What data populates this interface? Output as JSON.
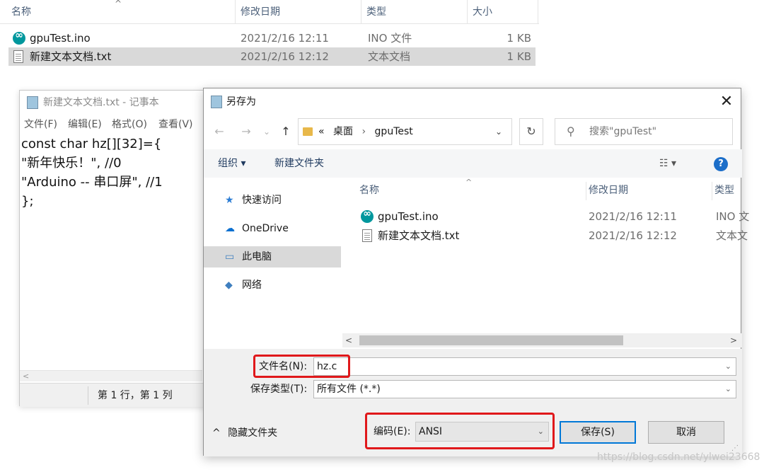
{
  "explorer": {
    "columns": [
      "名称",
      "修改日期",
      "类型",
      "大小"
    ],
    "files": [
      {
        "name": "gpuTest.ino",
        "date": "2021/2/16 12:11",
        "type": "INO 文件",
        "size": "1 KB"
      },
      {
        "name": "新建文本文档.txt",
        "date": "2021/2/16 12:12",
        "type": "文本文档",
        "size": "1 KB"
      }
    ]
  },
  "notepad": {
    "title": "新建文本文档.txt - 记事本",
    "menu": [
      "文件(F)",
      "编辑(E)",
      "格式(O)",
      "查看(V)"
    ],
    "lines": [
      "const char hz[][32]={",
      "\"新年快乐！\", //0",
      "\"Arduino -- 串口屏\", //1",
      "};"
    ],
    "status_position": "第 1 行，第 1 列"
  },
  "dialog": {
    "title": "另存为",
    "close_glyph": "✕",
    "nav": {
      "back": "←",
      "forward": "→",
      "recent": "⌄",
      "up": "↑"
    },
    "address": {
      "prefix": "«",
      "segment1": "桌面",
      "sep": "›",
      "segment2": "gpuTest",
      "drop": "⌄"
    },
    "refresh_glyph": "↻",
    "search": {
      "placeholder": "搜索\"gpuTest\""
    },
    "toolbar": {
      "organize": "组织 ▾",
      "new_folder": "新建文件夹",
      "view_glyph": "☷ ▾",
      "help": "?"
    },
    "nav_items": [
      {
        "label": "快速访问",
        "icon": "★",
        "color": "#2c7dd4"
      },
      {
        "label": "OneDrive",
        "icon": "☁",
        "color": "#0a6fd0"
      },
      {
        "label": "此电脑",
        "icon": "▭",
        "color": "#3f7fbf"
      },
      {
        "label": "网络",
        "icon": "◆",
        "color": "#3f7fbf"
      }
    ],
    "list_columns": [
      "名称",
      "修改日期",
      "类型"
    ],
    "files": [
      {
        "name": "gpuTest.ino",
        "date": "2021/2/16 12:11",
        "type": "INO 文"
      },
      {
        "name": "新建文本文档.txt",
        "date": "2021/2/16 12:12",
        "type": "文本文"
      }
    ],
    "file_name_label": "文件名(N):",
    "file_name_value": "hz.c",
    "save_type_label": "保存类型(T):",
    "save_type_value": "所有文件  (*.*)",
    "hide_folders": "隐藏文件夹",
    "encoding_label": "编码(E):",
    "encoding_value": "ANSI",
    "save_button": "保存(S)",
    "cancel_button": "取消"
  },
  "watermark": "https://blog.csdn.net/ylwei23668"
}
